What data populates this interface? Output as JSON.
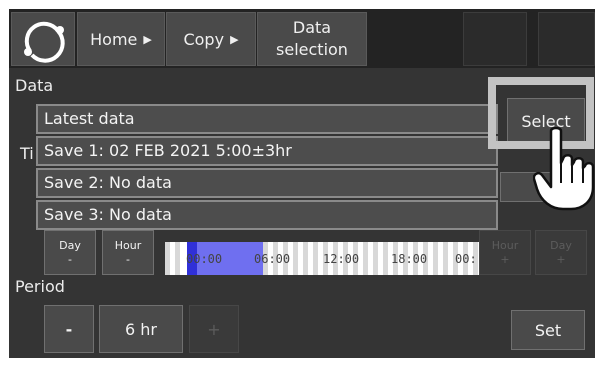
{
  "header": {
    "breadcrumbs": [
      {
        "label": "Home"
      },
      {
        "label": "Copy"
      }
    ],
    "current_line1": "Data",
    "current_line2": "selection",
    "arrow": "▶"
  },
  "data_section": {
    "label": "Data",
    "select_label": "Select"
  },
  "dropdown": {
    "options": [
      "Latest data",
      "Save 1: 02 FEB 2021 5:00±3hr",
      "Save 2: No data",
      "Save 3: No data"
    ]
  },
  "time_section": {
    "label_partial": "Ti",
    "day_minus_line1": "Day",
    "day_minus_line2": "-",
    "hour_minus_line1": "Hour",
    "hour_minus_line2": "-",
    "hour_plus_line1": "Hour",
    "hour_plus_line2": "+",
    "day_plus_line1": "Day",
    "day_plus_line2": "+",
    "timeline_ticks": [
      "00:00",
      "06:00",
      "12:00",
      "18:00",
      "00:"
    ]
  },
  "period_section": {
    "label": "Period",
    "minus_label": "-",
    "value": "6 hr",
    "plus_label": "+",
    "set_label": "Set"
  },
  "colors": {
    "screen_bg": "#343434",
    "button_bg": "#4a4a4a",
    "timeline_selection": "#6f6ff0"
  }
}
